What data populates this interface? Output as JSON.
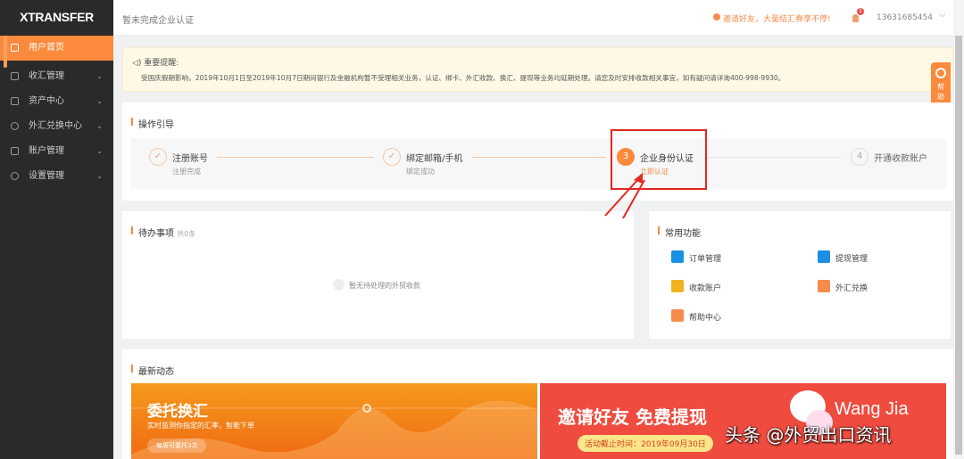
{
  "sidebar": {
    "logo": "XTRANSFER",
    "items": [
      {
        "label": "用户首页"
      },
      {
        "label": "收汇管理"
      },
      {
        "label": "资产中心"
      },
      {
        "label": "外汇兑换中心"
      },
      {
        "label": "账户管理"
      },
      {
        "label": "设置管理"
      }
    ]
  },
  "header": {
    "status": "暂未完成企业认证",
    "promo": "邀请好友，大量结汇券享不停!",
    "badge": "1",
    "phone": "13631685454"
  },
  "notice": {
    "title": "重要提醒:",
    "text": "受国庆假期影响，2019年10月1日至2019年10月7日期间银行及金融机构暂不受理相关业务，认证、绑卡、外汇收款、换汇、提现等业务均延期处理。请您及时安排收款相关事宜，如有疑问请详询400-998-9930。"
  },
  "help": {
    "label": "帮助·服务"
  },
  "guide": {
    "title": "操作引导",
    "steps": [
      {
        "num": "✓",
        "title": "注册账号",
        "sub": "注册完成"
      },
      {
        "num": "✓",
        "title": "绑定邮箱/手机",
        "sub": "绑定成功"
      },
      {
        "num": "3",
        "title": "企业身份认证",
        "sub": "立即认证"
      },
      {
        "num": "4",
        "title": "开通收款账户",
        "sub": ""
      }
    ]
  },
  "todo": {
    "title": "待办事项",
    "count": "共0条",
    "empty": "暂无待处理的外贸收款"
  },
  "common": {
    "title": "常用功能",
    "items": [
      {
        "label": "订单管理",
        "color": "#1a8fe3"
      },
      {
        "label": "提现管理",
        "color": "#1a8fe3"
      },
      {
        "label": "收款账户",
        "color": "#f0b21e"
      },
      {
        "label": "外汇兑换",
        "color": "#f58b4c"
      },
      {
        "label": "帮助中心",
        "color": "#f58b4c"
      }
    ]
  },
  "news": {
    "title": "最新动态",
    "banner1": {
      "title": "委托换汇",
      "sub": "实时监测你指定的汇率，智能下单",
      "btn": "每周可委托3次"
    },
    "banner2": {
      "title": "邀请好友 免费提现",
      "date": "活动截止时间：2019年09月30日",
      "brand": "Wang Jia"
    }
  },
  "watermark": "头条 @外贸出口资讯"
}
